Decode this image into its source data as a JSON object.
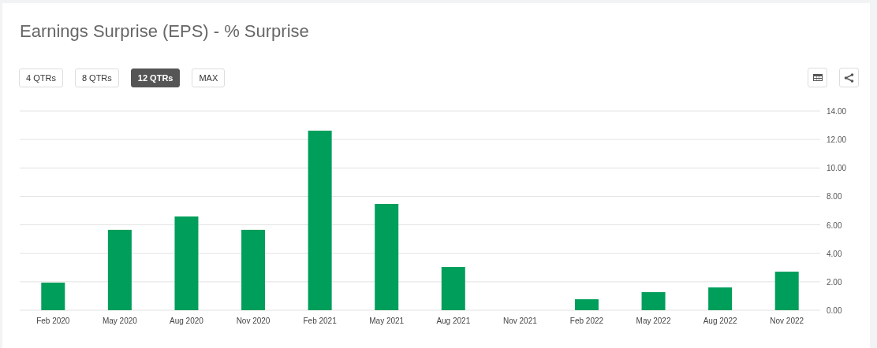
{
  "title": "Earnings Surprise (EPS) - % Surprise",
  "ranges": [
    {
      "label": "4 QTRs",
      "selected": false
    },
    {
      "label": "8 QTRs",
      "selected": false
    },
    {
      "label": "12 QTRs",
      "selected": true
    },
    {
      "label": "MAX",
      "selected": false
    }
  ],
  "chart_data": {
    "type": "bar",
    "categories": [
      "Feb 2020",
      "May 2020",
      "Aug 2020",
      "Nov 2020",
      "Feb 2021",
      "May 2021",
      "Aug 2021",
      "Nov 2021",
      "Feb 2022",
      "May 2022",
      "Aug 2022",
      "Nov 2022"
    ],
    "grid": true,
    "series": [
      {
        "color": "#009e5b",
        "values": [
          1.94,
          5.65,
          6.59,
          5.65,
          12.62,
          7.47,
          3.04,
          null,
          0.77,
          1.27,
          1.6,
          2.71
        ]
      }
    ],
    "ylim": [
      0,
      14
    ],
    "yticks": [
      {
        "value": 0,
        "label": "0.00"
      },
      {
        "value": 2,
        "label": "2.00"
      },
      {
        "value": 4,
        "label": "4.00"
      },
      {
        "value": 6,
        "label": "6.00"
      },
      {
        "value": 8,
        "label": "8.00"
      },
      {
        "value": 10,
        "label": "10.00"
      },
      {
        "value": 12,
        "label": "12.00"
      },
      {
        "value": 14,
        "label": "14.00"
      }
    ]
  }
}
